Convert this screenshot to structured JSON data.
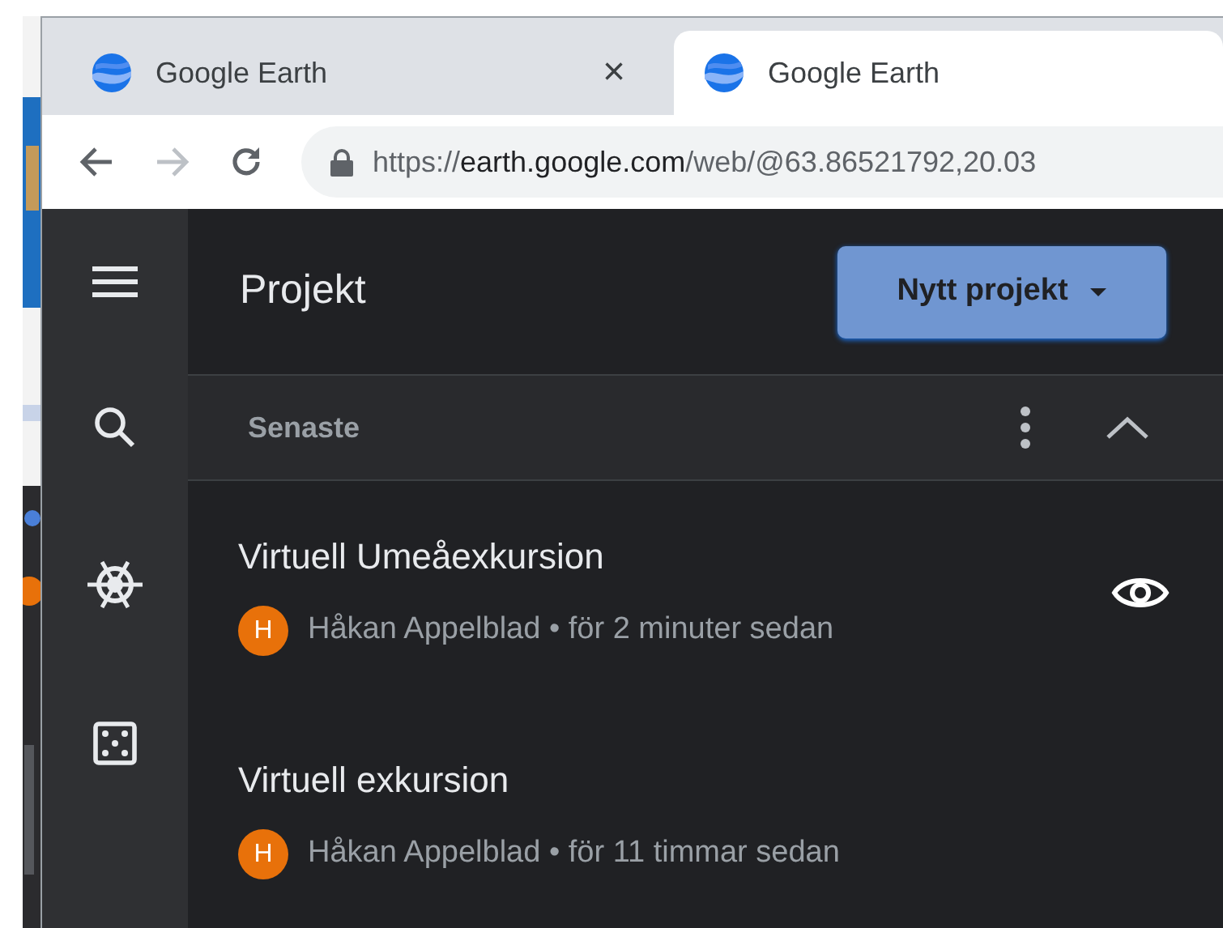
{
  "browser": {
    "tabs": [
      {
        "title": "Google Earth",
        "selected": false,
        "close": "×"
      },
      {
        "title": "Google Earth",
        "selected": true
      }
    ],
    "address": {
      "scheme": "https://",
      "host": "earth.google.com",
      "path": "/web/@63.86521792,20.03"
    }
  },
  "sidebar": {
    "items": [
      {
        "kind": "menu"
      },
      {
        "kind": "search"
      },
      {
        "kind": "wheel"
      },
      {
        "kind": "dice"
      }
    ]
  },
  "panel": {
    "title": "Projekt",
    "new_button": "Nytt projekt",
    "section": {
      "title": "Senaste",
      "expanded": true
    },
    "projects": [
      {
        "title": "Virtuell Umeåexkursion",
        "avatar": "H",
        "meta": "Håkan Appelblad • för 2 minuter sedan",
        "hovered": true
      },
      {
        "title": "Virtuell exkursion",
        "avatar": "H",
        "meta": "Håkan Appelblad • för 11 timmar sedan",
        "hovered": false
      }
    ]
  }
}
